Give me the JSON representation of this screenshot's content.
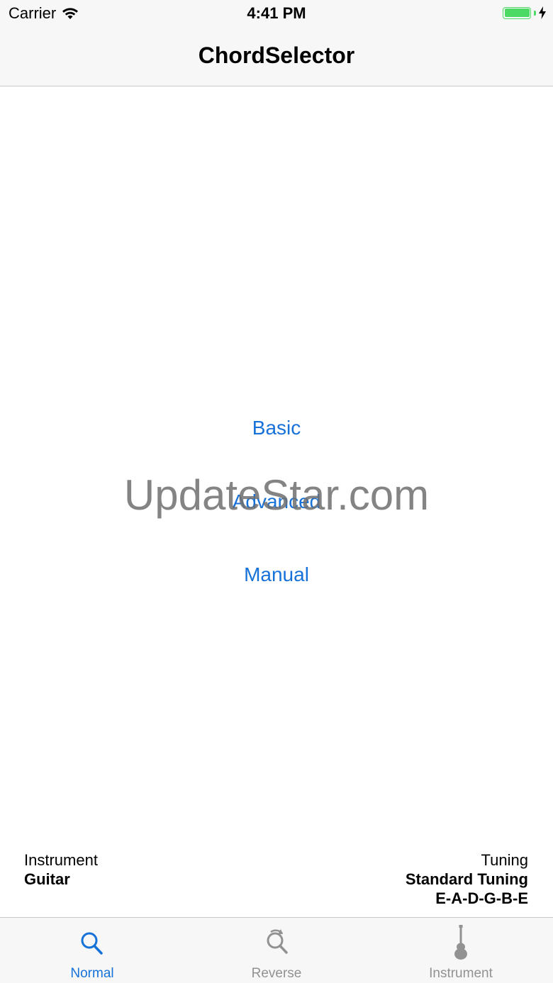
{
  "status_bar": {
    "carrier": "Carrier",
    "time": "4:41 PM"
  },
  "nav": {
    "title": "ChordSelector"
  },
  "menu": {
    "basic": "Basic",
    "advanced": "Advanced",
    "manual": "Manual"
  },
  "watermark": "UpdateStar.com",
  "info": {
    "instrument_label": "Instrument",
    "instrument_value": "Guitar",
    "tuning_label": "Tuning",
    "tuning_value": "Standard Tuning",
    "tuning_notes": "E-A-D-G-B-E"
  },
  "tabs": [
    {
      "label": "Normal",
      "icon": "search-icon",
      "active": true
    },
    {
      "label": "Reverse",
      "icon": "reverse-search-icon",
      "active": false
    },
    {
      "label": "Instrument",
      "icon": "guitar-icon",
      "active": false
    }
  ],
  "colors": {
    "accent": "#1671d9",
    "battery": "#4cd964",
    "inactive_tab": "#929292"
  }
}
